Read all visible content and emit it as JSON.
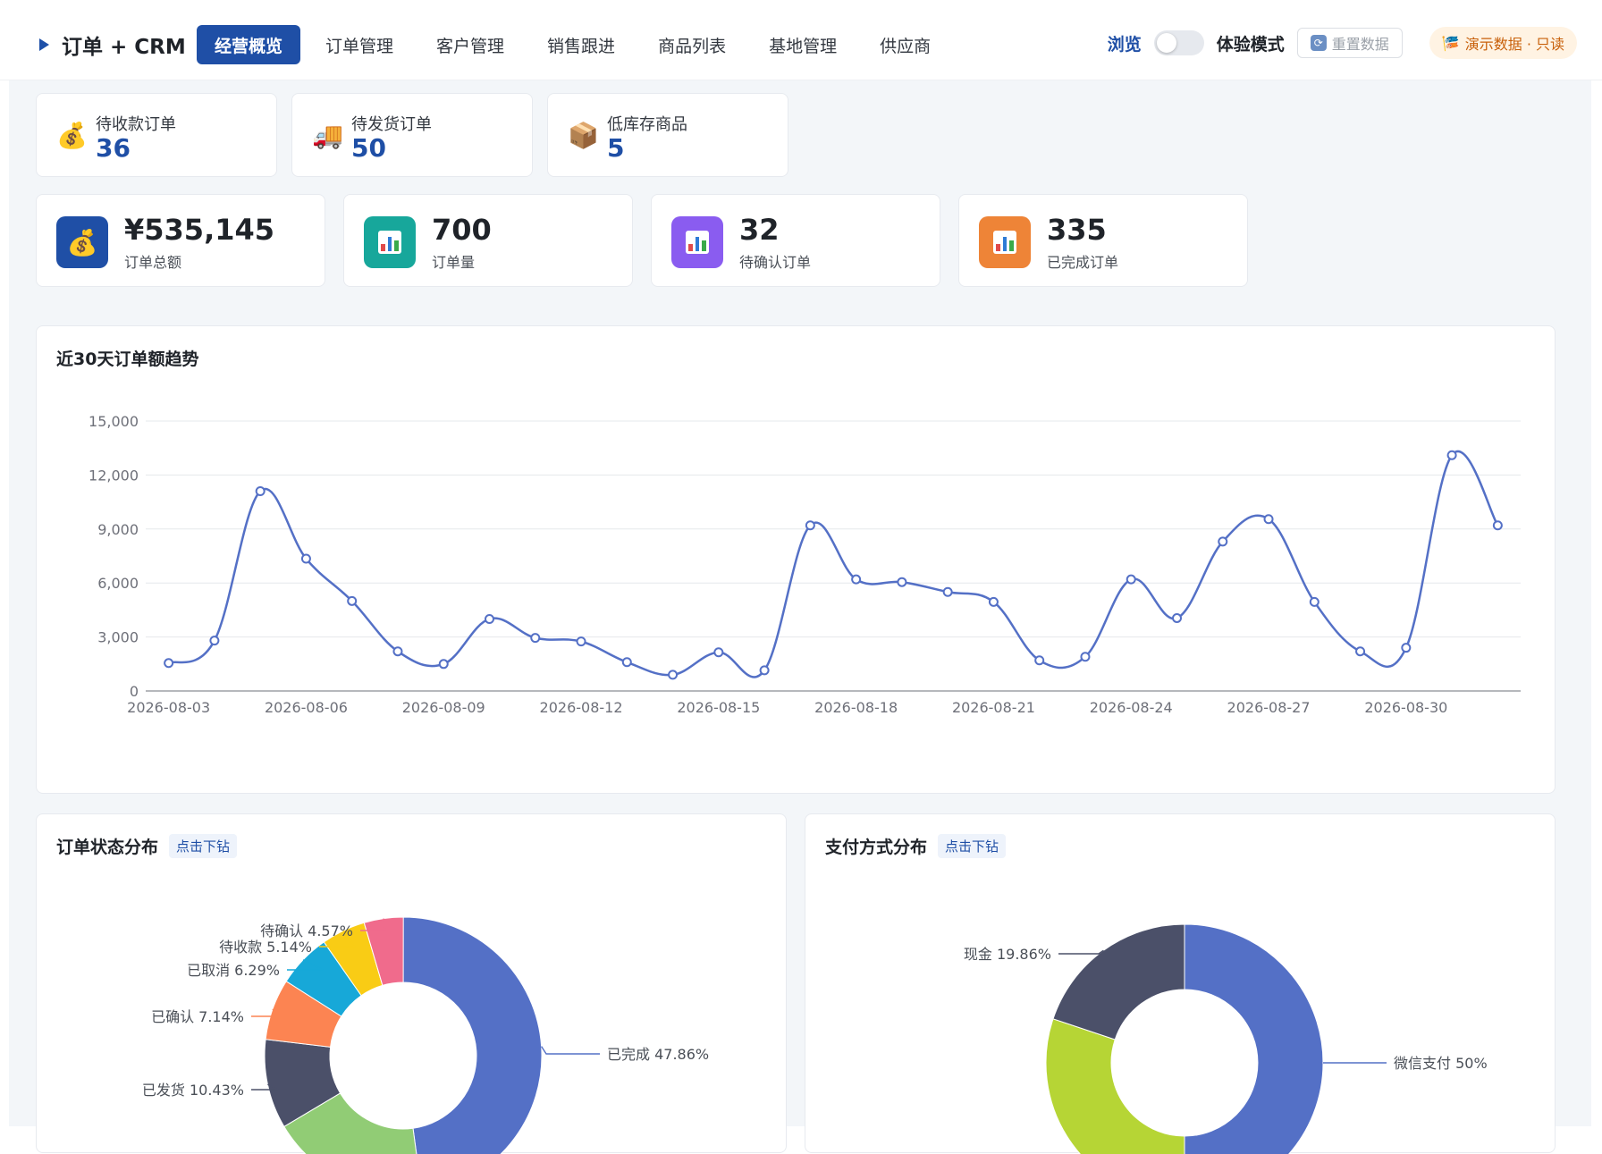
{
  "app": {
    "brand": "订单 + CRM",
    "nav": [
      {
        "label": "经营概览",
        "active": true
      },
      {
        "label": "订单管理",
        "active": false
      },
      {
        "label": "客户管理",
        "active": false
      },
      {
        "label": "销售跟进",
        "active": false
      },
      {
        "label": "商品列表",
        "active": false
      },
      {
        "label": "基地管理",
        "active": false
      },
      {
        "label": "供应商",
        "active": false
      }
    ],
    "browse_label": "浏览",
    "mode_label": "体验模式",
    "reset_label": "重置数据",
    "demo_badge": "演示数据 · 只读"
  },
  "small_stats": [
    {
      "label": "待收款订单",
      "value": "36",
      "icon": "money-bag-icon",
      "glyph": "💰"
    },
    {
      "label": "待发货订单",
      "value": "50",
      "icon": "delivery-truck-icon",
      "glyph": "🚚"
    },
    {
      "label": "低库存商品",
      "value": "5",
      "icon": "package-icon",
      "glyph": "📦"
    }
  ],
  "big_stats": [
    {
      "value": "¥535,145",
      "label": "订单总额",
      "icon": "money-bag-icon",
      "color": "#1f4fa6"
    },
    {
      "value": "700",
      "label": "订单量",
      "icon": "bar-chart-icon",
      "color": "#17a79b"
    },
    {
      "value": "32",
      "label": "待确认订单",
      "icon": "bar-chart-icon",
      "color": "#8a5cf0"
    },
    {
      "value": "335",
      "label": "已完成订单",
      "icon": "bar-chart-icon",
      "color": "#ee8437"
    }
  ],
  "colors": {
    "primary": "#1f4fa6",
    "line": "#5470c6"
  },
  "chart_data": [
    {
      "type": "line",
      "title": "近30天订单额趋势",
      "x": [
        "2026-08-03",
        "2026-08-04",
        "2026-08-05",
        "2026-08-06",
        "2026-08-07",
        "2026-08-08",
        "2026-08-09",
        "2026-08-10",
        "2026-08-11",
        "2026-08-12",
        "2026-08-13",
        "2026-08-14",
        "2026-08-15",
        "2026-08-16",
        "2026-08-17",
        "2026-08-18",
        "2026-08-19",
        "2026-08-20",
        "2026-08-21",
        "2026-08-22",
        "2026-08-23",
        "2026-08-24",
        "2026-08-25",
        "2026-08-26",
        "2026-08-27",
        "2026-08-28",
        "2026-08-29",
        "2026-08-30",
        "2026-08-31",
        "2026-09-01"
      ],
      "x_tick_labels": [
        "2026-08-03",
        "2026-08-06",
        "2026-08-09",
        "2026-08-12",
        "2026-08-15",
        "2026-08-18",
        "2026-08-21",
        "2026-08-24",
        "2026-08-27",
        "2026-08-30"
      ],
      "values": [
        1550,
        2800,
        11100,
        7350,
        5000,
        2200,
        1500,
        4000,
        2950,
        2750,
        1600,
        900,
        2150,
        1150,
        9200,
        6200,
        6050,
        5500,
        4950,
        1700,
        1900,
        6200,
        4050,
        8300,
        9550,
        4950,
        2200,
        2400,
        13100,
        9200
      ],
      "ylim": [
        0,
        15000
      ],
      "y_ticks": [
        "0",
        "3,000",
        "6,000",
        "9,000",
        "12,000",
        "15,000"
      ],
      "grid": true
    },
    {
      "type": "pie",
      "title": "订单状态分布",
      "tag": "点击下钻",
      "slices": [
        {
          "label": "已完成",
          "percent": 47.86,
          "display": "已完成 47.86%",
          "color": "#5470c6"
        },
        {
          "label": "",
          "percent": 18.59,
          "display": "",
          "color": "#91cc75"
        },
        {
          "label": "已发货",
          "percent": 10.43,
          "display": "已发货 10.43%",
          "color": "#4b5069"
        },
        {
          "label": "已确认",
          "percent": 7.14,
          "display": "已确认 7.14%",
          "color": "#fc8452"
        },
        {
          "label": "已取消",
          "percent": 6.29,
          "display": "已取消 6.29%",
          "color": "#17a8d8"
        },
        {
          "label": "待收款",
          "percent": 5.14,
          "display": "待收款 5.14%",
          "color": "#f9cc15"
        },
        {
          "label": "待确认",
          "percent": 4.57,
          "display": "待确认 4.57%",
          "color": "#f06b8c"
        }
      ]
    },
    {
      "type": "pie",
      "title": "支付方式分布",
      "tag": "点击下钻",
      "slices": [
        {
          "label": "微信支付",
          "percent": 50,
          "display": "微信支付 50%",
          "color": "#5470c6"
        },
        {
          "label": "",
          "percent": 30.14,
          "display": "",
          "color": "#b6d535"
        },
        {
          "label": "现金",
          "percent": 19.86,
          "display": "现金 19.86%",
          "color": "#4b5069"
        }
      ]
    }
  ]
}
